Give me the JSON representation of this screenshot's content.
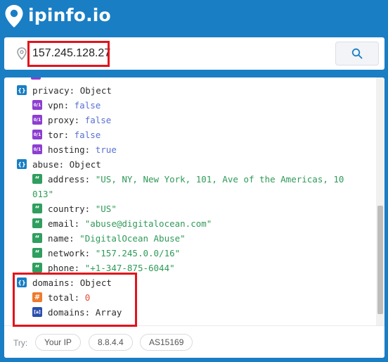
{
  "brand": {
    "name": "ipinfo.io"
  },
  "search": {
    "value": "157.245.128.27"
  },
  "json_view": {
    "privacy": {
      "label": "privacy: Object",
      "fields": [
        {
          "key": "vpn:",
          "value": "false"
        },
        {
          "key": "proxy:",
          "value": "false"
        },
        {
          "key": "tor:",
          "value": "false"
        },
        {
          "key": "hosting:",
          "value": "true"
        }
      ]
    },
    "abuse": {
      "label": "abuse: Object",
      "address_key": "address:",
      "address_value_line1": "\"US, NY, New York, 101, Ave of the Americas, 10",
      "address_value_line2": "013\"",
      "fields": [
        {
          "key": "country:",
          "value": "\"US\""
        },
        {
          "key": "email:",
          "value": "\"abuse@digitalocean.com\""
        },
        {
          "key": "name:",
          "value": "\"DigitalOcean Abuse\""
        },
        {
          "key": "network:",
          "value": "\"157.245.0.0/16\""
        },
        {
          "key": "phone:",
          "value": "\"+1-347-875-6044\""
        }
      ]
    },
    "domains": {
      "label": "domains: Object",
      "total_key": "total:",
      "total_value": "0",
      "domains_key": "domains:",
      "domains_value": "Array"
    }
  },
  "badges": {
    "object": "{}",
    "bool": "0/1",
    "string": "“",
    "number": "#",
    "array": "[a]"
  },
  "try": {
    "label": "Try:",
    "options": [
      "Your IP",
      "8.8.4.4",
      "AS15169"
    ]
  },
  "colors": {
    "background": "#1a7ec4",
    "highlight": "#e3131b"
  }
}
